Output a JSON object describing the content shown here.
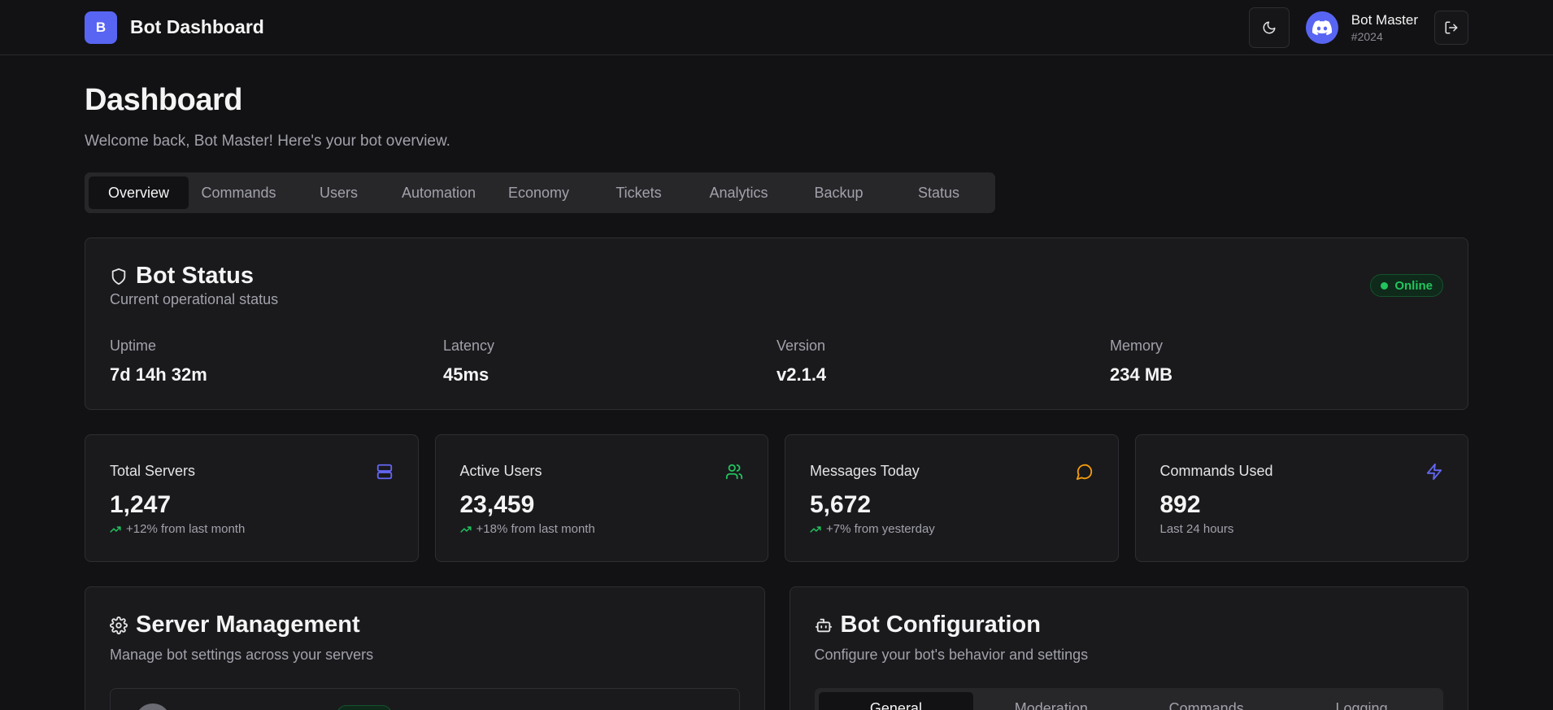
{
  "header": {
    "logo_letter": "B",
    "title": "Bot Dashboard",
    "theme_icon": "moon-icon",
    "user": {
      "name": "Bot Master",
      "tag": "#2024",
      "avatar_icon": "discord-icon"
    },
    "logout_icon": "logout-icon"
  },
  "page": {
    "title": "Dashboard",
    "subtitle": "Welcome back, Bot Master! Here's your bot overview."
  },
  "tabs": [
    "Overview",
    "Commands",
    "Users",
    "Automation",
    "Economy",
    "Tickets",
    "Analytics",
    "Backup",
    "Status"
  ],
  "active_tab": "Overview",
  "bot_status": {
    "title": "Bot Status",
    "description": "Current operational status",
    "badge": "Online",
    "stats": [
      {
        "label": "Uptime",
        "value": "7d 14h 32m"
      },
      {
        "label": "Latency",
        "value": "45ms"
      },
      {
        "label": "Version",
        "value": "v2.1.4"
      },
      {
        "label": "Memory",
        "value": "234 MB"
      }
    ]
  },
  "metrics": [
    {
      "label": "Total Servers",
      "value": "1,247",
      "sub": "+12% from last month",
      "icon": "server-icon",
      "trend": true,
      "color": "#6366f1"
    },
    {
      "label": "Active Users",
      "value": "23,459",
      "sub": "+18% from last month",
      "icon": "users-icon",
      "trend": true,
      "color": "#22c55e"
    },
    {
      "label": "Messages Today",
      "value": "5,672",
      "sub": "+7% from yesterday",
      "icon": "message-icon",
      "trend": true,
      "color": "#f59e0b"
    },
    {
      "label": "Commands Used",
      "value": "892",
      "sub": "Last 24 hours",
      "icon": "zap-icon",
      "trend": false,
      "color": "#6366f1"
    }
  ],
  "server_management": {
    "title": "Server Management",
    "description": "Manage bot settings across your servers"
  },
  "bot_configuration": {
    "title": "Bot Configuration",
    "description": "Configure your bot's behavior and settings",
    "tabs": [
      "General",
      "Moderation",
      "Commands",
      "Logging"
    ],
    "active_tab": "General"
  },
  "colors": {
    "accent": "#5865f2",
    "success": "#22c55e",
    "background": "#121214",
    "card": "#1a1a1d"
  }
}
